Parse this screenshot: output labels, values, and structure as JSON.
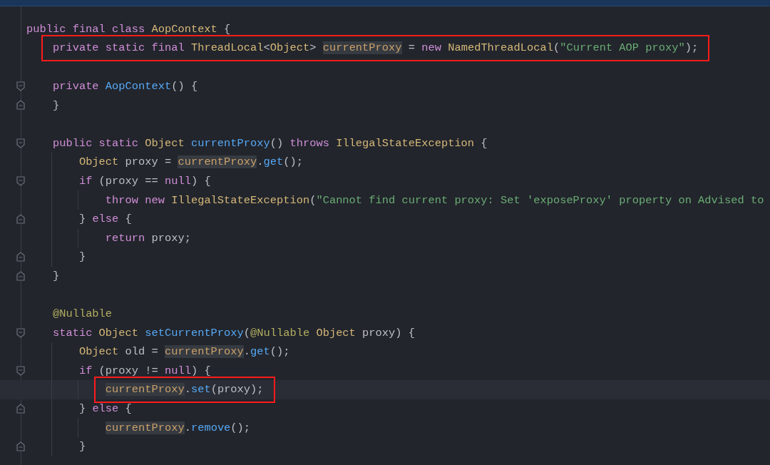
{
  "editor": {
    "lines": [
      {
        "kind": "code",
        "current": false,
        "boxed": false,
        "tokens": [
          {
            "kind": "keyword",
            "text": "public final class "
          },
          {
            "kind": "type",
            "text": "AopContext"
          },
          {
            "kind": "plain",
            "text": " {"
          }
        ]
      },
      {
        "kind": "code",
        "current": false,
        "boxed": true,
        "tokens": [
          {
            "kind": "keyword",
            "text": "    private static final "
          },
          {
            "kind": "type",
            "text": "ThreadLocal"
          },
          {
            "kind": "plain",
            "text": "<"
          },
          {
            "kind": "type",
            "text": "Object"
          },
          {
            "kind": "plain",
            "text": "> "
          },
          {
            "kind": "field",
            "text": "currentProxy"
          },
          {
            "kind": "plain",
            "text": " = "
          },
          {
            "kind": "keyword",
            "text": "new "
          },
          {
            "kind": "type",
            "text": "NamedThreadLocal"
          },
          {
            "kind": "plain",
            "text": "("
          },
          {
            "kind": "string",
            "text": "\"Current AOP proxy\""
          },
          {
            "kind": "plain",
            "text": ");"
          }
        ]
      },
      {
        "kind": "blank",
        "current": false,
        "boxed": false
      },
      {
        "kind": "block_start",
        "current": false,
        "boxed": false,
        "tokens": [
          {
            "kind": "keyword",
            "text": "    private "
          },
          {
            "kind": "function",
            "text": "AopContext"
          },
          {
            "kind": "plain",
            "text": "() {"
          }
        ]
      },
      {
        "kind": "block_end",
        "current": false,
        "boxed": false,
        "tokens": [
          {
            "kind": "plain",
            "text": "    }"
          }
        ]
      },
      {
        "kind": "blank",
        "current": false,
        "boxed": false
      },
      {
        "kind": "block_start",
        "current": false,
        "boxed": false,
        "tokens": [
          {
            "kind": "keyword",
            "text": "    public static "
          },
          {
            "kind": "type",
            "text": "Object "
          },
          {
            "kind": "function",
            "text": "currentProxy"
          },
          {
            "kind": "plain",
            "text": "() "
          },
          {
            "kind": "keyword",
            "text": "throws "
          },
          {
            "kind": "type",
            "text": "IllegalStateException"
          },
          {
            "kind": "plain",
            "text": " {"
          }
        ]
      },
      {
        "kind": "code",
        "current": false,
        "boxed": false,
        "tokens": [
          {
            "kind": "type",
            "text": "        Object "
          },
          {
            "kind": "plain",
            "text": "proxy = "
          },
          {
            "kind": "field",
            "text": "currentProxy"
          },
          {
            "kind": "plain",
            "text": "."
          },
          {
            "kind": "function",
            "text": "get"
          },
          {
            "kind": "plain",
            "text": "();"
          }
        ]
      },
      {
        "kind": "block_start",
        "current": false,
        "boxed": false,
        "tokens": [
          {
            "kind": "keyword",
            "text": "        if "
          },
          {
            "kind": "plain",
            "text": "(proxy == "
          },
          {
            "kind": "keyword",
            "text": "null"
          },
          {
            "kind": "plain",
            "text": ") {"
          }
        ]
      },
      {
        "kind": "code",
        "current": false,
        "boxed": false,
        "tokens": [
          {
            "kind": "keyword",
            "text": "            throw new "
          },
          {
            "kind": "type",
            "text": "IllegalStateException"
          },
          {
            "kind": "plain",
            "text": "("
          },
          {
            "kind": "string",
            "text": "\"Cannot find current proxy: Set 'exposeProxy' property on Advised to"
          }
        ]
      },
      {
        "kind": "block_end",
        "current": false,
        "boxed": false,
        "tokens": [
          {
            "kind": "plain",
            "text": "        } "
          },
          {
            "kind": "keyword",
            "text": "else "
          },
          {
            "kind": "plain",
            "text": "{"
          }
        ]
      },
      {
        "kind": "code",
        "current": false,
        "boxed": false,
        "tokens": [
          {
            "kind": "keyword",
            "text": "            return "
          },
          {
            "kind": "plain",
            "text": "proxy;"
          }
        ]
      },
      {
        "kind": "block_end",
        "current": false,
        "boxed": false,
        "tokens": [
          {
            "kind": "plain",
            "text": "        }"
          }
        ]
      },
      {
        "kind": "block_end",
        "current": false,
        "boxed": false,
        "tokens": [
          {
            "kind": "plain",
            "text": "    }"
          }
        ]
      },
      {
        "kind": "blank",
        "current": false,
        "boxed": false
      },
      {
        "kind": "code",
        "current": false,
        "boxed": false,
        "tokens": [
          {
            "kind": "annotation",
            "text": "    @Nullable"
          }
        ]
      },
      {
        "kind": "block_start",
        "current": false,
        "boxed": false,
        "tokens": [
          {
            "kind": "keyword",
            "text": "    static "
          },
          {
            "kind": "type",
            "text": "Object "
          },
          {
            "kind": "function",
            "text": "setCurrentProxy"
          },
          {
            "kind": "plain",
            "text": "("
          },
          {
            "kind": "annotation",
            "text": "@Nullable "
          },
          {
            "kind": "type",
            "text": "Object "
          },
          {
            "kind": "plain",
            "text": "proxy) {"
          }
        ]
      },
      {
        "kind": "code",
        "current": false,
        "boxed": false,
        "tokens": [
          {
            "kind": "type",
            "text": "        Object "
          },
          {
            "kind": "plain",
            "text": "old = "
          },
          {
            "kind": "field",
            "text": "currentProxy"
          },
          {
            "kind": "plain",
            "text": "."
          },
          {
            "kind": "function",
            "text": "get"
          },
          {
            "kind": "plain",
            "text": "();"
          }
        ]
      },
      {
        "kind": "block_start",
        "current": false,
        "boxed": false,
        "tokens": [
          {
            "kind": "keyword",
            "text": "        if "
          },
          {
            "kind": "plain",
            "text": "(proxy != "
          },
          {
            "kind": "keyword",
            "text": "null"
          },
          {
            "kind": "plain",
            "text": ") {"
          }
        ]
      },
      {
        "kind": "code",
        "current": true,
        "boxed": true,
        "tokens": [
          {
            "kind": "field",
            "text": "            currentProxy"
          },
          {
            "kind": "plain",
            "text": "."
          },
          {
            "kind": "function",
            "text": "set"
          },
          {
            "kind": "plain",
            "text": "(proxy);"
          }
        ]
      },
      {
        "kind": "block_end",
        "current": false,
        "boxed": false,
        "tokens": [
          {
            "kind": "plain",
            "text": "        } "
          },
          {
            "kind": "keyword",
            "text": "else "
          },
          {
            "kind": "plain",
            "text": "{"
          }
        ]
      },
      {
        "kind": "code",
        "current": false,
        "boxed": false,
        "tokens": [
          {
            "kind": "field",
            "text": "            currentProxy"
          },
          {
            "kind": "plain",
            "text": "."
          },
          {
            "kind": "function",
            "text": "remove"
          },
          {
            "kind": "plain",
            "text": "();"
          }
        ]
      },
      {
        "kind": "block_end",
        "current": false,
        "boxed": false,
        "tokens": [
          {
            "kind": "plain",
            "text": "        }"
          }
        ]
      }
    ]
  }
}
